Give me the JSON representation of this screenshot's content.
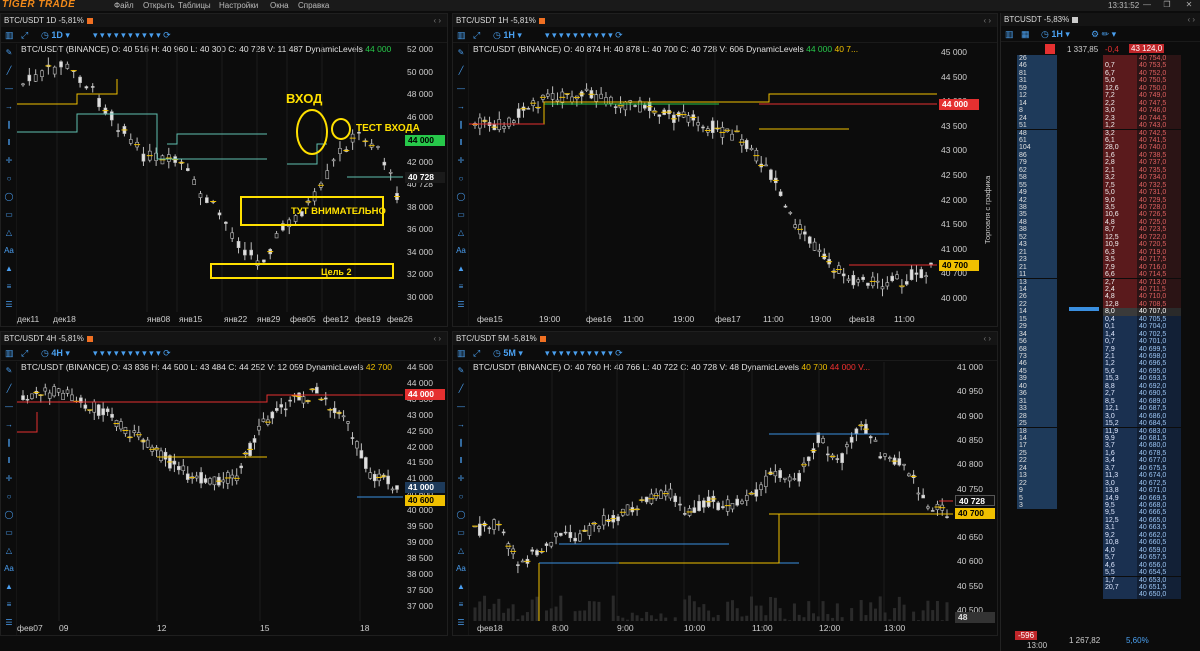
{
  "app": {
    "logo": "TIGER TRADE",
    "menu": [
      "Файл",
      "Открыть",
      "Таблицы",
      "Настройки",
      "Окна",
      "Справка"
    ],
    "clock": "13:31:52"
  },
  "colors": {
    "up": "#d8d8d8",
    "accent": "#f07022",
    "green": "#27c84a",
    "yellow": "#f0c000",
    "red": "#e53030",
    "blue": "#3a8fe0"
  },
  "panel1": {
    "title": "BTC/USDT 1D -5,81%",
    "timeframe": "1D",
    "info": "BTC/USDT (BINANCE) O: 40 516  H: 40 960  L: 40 300  C: 40 728  V: 11 487  DynamicLevels",
    "info_level": "44 000",
    "yticks": [
      "52 000",
      "50 000",
      "48 000",
      "46 000",
      "44 000",
      "42 000",
      "40 728",
      "38 000",
      "36 000",
      "34 000",
      "32 000",
      "30 000"
    ],
    "xticks": [
      "дек11",
      "дек18",
      "янв08",
      "янв15",
      "янв22",
      "янв29",
      "фев05",
      "фев12",
      "фев19",
      "фев26"
    ],
    "price_green": "44 000",
    "price_last": "40 728",
    "annotations": {
      "entry": "ВХОД",
      "entry_test": "ТЕСТ ВХОДА",
      "careful": "ТУТ ВНИМАТЕЛЬНО",
      "target": "Цель 2"
    }
  },
  "panel2": {
    "title": "BTC/USDT 1H -5,81%",
    "timeframe": "1H",
    "info": "BTC/USDT (BINANCE) O: 40 874  H: 40 878  L: 40 700  C: 40 728  V: 606  DynamicLevels",
    "info_g": "44 000",
    "info_y": "40 7...",
    "yticks": [
      "45 000",
      "44 500",
      "44 000",
      "43 500",
      "43 000",
      "42 500",
      "42 000",
      "41 500",
      "41 000",
      "40 700",
      "40 000"
    ],
    "xticks": [
      "фев15",
      "19:00",
      "фев16",
      "11:00",
      "19:00",
      "фев17",
      "11:00",
      "19:00",
      "фев18",
      "11:00"
    ],
    "price_red": "44 000",
    "price_yellow": "40 700",
    "side_label": "Торговля с графика"
  },
  "panel3": {
    "title": "BTC/USDT 4H -5,81%",
    "timeframe": "4H",
    "info": "BTC/USDT (BINANCE) O: 43 836  H: 44 500  L: 43 484  C: 44 252  V: 12 059  DynamicLevels",
    "info_y": "42 700",
    "yticks": [
      "44 500",
      "44 000",
      "43 500",
      "43 000",
      "42 500",
      "42 000",
      "41 500",
      "41 000",
      "40 600",
      "40 000",
      "39 500",
      "39 000",
      "38 500",
      "38 000",
      "37 500",
      "37 000"
    ],
    "xticks": [
      "фев07",
      "09",
      "12",
      "15",
      "18"
    ],
    "price_red": "44 000",
    "price_blue": "41 000",
    "price_yellow": "40 600"
  },
  "panel4": {
    "title": "BTC/USDT 5M -5,81%",
    "timeframe": "5M",
    "info": "BTC/USDT (BINANCE) O: 40 760  H: 40 766  L: 40 722  C: 40 728  V: 48  DynamicLevels",
    "info_y": "40 700",
    "info_r": "44 000  V...",
    "yticks": [
      "41 000",
      "40 950",
      "40 900",
      "40 850",
      "40 800",
      "40 750",
      "40 700",
      "40 650",
      "40 600",
      "40 550",
      "40 500"
    ],
    "xticks": [
      "фев18",
      "8:00",
      "9:00",
      "10:00",
      "11:00",
      "12:00",
      "13:00"
    ],
    "price_last": "40 728",
    "price_yellow": "40 700",
    "vol": "48"
  },
  "orderbook": {
    "title": "BTCUSDT -5,83%",
    "timeframe": "1H",
    "head_left": "1 337,85",
    "head_mid": "-0,4",
    "head_right": "43 124,0",
    "asks": [
      [
        "26",
        "",
        "40 754,0"
      ],
      [
        "46",
        "0,7",
        "40 753,5"
      ],
      [
        "81",
        "6,7",
        "40 752,0"
      ],
      [
        "31",
        "5,0",
        "40 750,5"
      ],
      [
        "59",
        "12,6",
        "40 750,0"
      ],
      [
        "12",
        "7,2",
        "40 749,0"
      ],
      [
        "14",
        "2,2",
        "40 747,5"
      ],
      [
        "8",
        "3,0",
        "40 746,0"
      ],
      [
        "24",
        "2,3",
        "40 744,5"
      ],
      [
        "51",
        "1,2",
        "40 743,0"
      ],
      [
        "48",
        "3,2",
        "40 742,5"
      ],
      [
        "61",
        "6,1",
        "40 741,5"
      ],
      [
        "104",
        "28,0",
        "40 740,0"
      ],
      [
        "86",
        "1,6",
        "40 738,5"
      ],
      [
        "79",
        "2,8",
        "40 737,0"
      ],
      [
        "62",
        "2,1",
        "40 735,5"
      ],
      [
        "58",
        "3,2",
        "40 734,0"
      ],
      [
        "55",
        "7,5",
        "40 732,5"
      ],
      [
        "49",
        "5,0",
        "40 731,0"
      ],
      [
        "42",
        "9,0",
        "40 729,5"
      ],
      [
        "38",
        "3,5",
        "40 728,0"
      ],
      [
        "35",
        "10,6",
        "40 726,5"
      ],
      [
        "48",
        "4,8",
        "40 725,0"
      ],
      [
        "38",
        "8,7",
        "40 723,5"
      ],
      [
        "52",
        "12,5",
        "40 722,0"
      ],
      [
        "43",
        "10,9",
        "40 720,5"
      ],
      [
        "21",
        "6,3",
        "40 719,0"
      ],
      [
        "23",
        "3,5",
        "40 717,5"
      ],
      [
        "21",
        "7,9",
        "40 716,0"
      ],
      [
        "11",
        "6,6",
        "40 714,5"
      ],
      [
        "13",
        "2,7",
        "40 713,0"
      ],
      [
        "14",
        "2,4",
        "40 711,5"
      ],
      [
        "26",
        "4,8",
        "40 710,0"
      ],
      [
        "22",
        "12,8",
        "40 708,5"
      ]
    ],
    "spread_row": [
      "14",
      "8,0",
      "40 707,0"
    ],
    "bids": [
      [
        "15",
        "0,4",
        "40 705,5"
      ],
      [
        "29",
        "0,1",
        "40 704,0"
      ],
      [
        "34",
        "1,4",
        "40 702,5"
      ],
      [
        "56",
        "0,7",
        "40 701,0"
      ],
      [
        "68",
        "7,9",
        "40 699,5"
      ],
      [
        "73",
        "2,1",
        "40 698,0"
      ],
      [
        "46",
        "1,2",
        "40 696,5"
      ],
      [
        "45",
        "5,6",
        "40 695,0"
      ],
      [
        "39",
        "15,3",
        "40 693,5"
      ],
      [
        "40",
        "8,8",
        "40 692,0"
      ],
      [
        "36",
        "2,7",
        "40 690,5"
      ],
      [
        "31",
        "8,5",
        "40 689,0"
      ],
      [
        "33",
        "12,1",
        "40 687,5"
      ],
      [
        "28",
        "3,0",
        "40 686,0"
      ],
      [
        "25",
        "15,2",
        "40 684,5"
      ],
      [
        "18",
        "11,9",
        "40 683,0"
      ],
      [
        "14",
        "9,9",
        "40 681,5"
      ],
      [
        "17",
        "3,7",
        "40 680,0"
      ],
      [
        "25",
        "1,6",
        "40 678,5"
      ],
      [
        "22",
        "3,4",
        "40 677,0"
      ],
      [
        "24",
        "3,7",
        "40 675,5"
      ],
      [
        "13",
        "11,3",
        "40 674,0"
      ],
      [
        "22",
        "3,0",
        "40 672,5"
      ],
      [
        "9",
        "13,8",
        "40 671,0"
      ],
      [
        "5",
        "14,9",
        "40 669,5"
      ],
      [
        "3",
        "9,5",
        "40 668,0"
      ],
      [
        "",
        "9,5",
        "40 666,5"
      ],
      [
        "",
        "12,5",
        "40 665,0"
      ],
      [
        "",
        "3,1",
        "40 663,5"
      ],
      [
        "",
        "9,2",
        "40 662,0"
      ],
      [
        "",
        "10,8",
        "40 660,5"
      ],
      [
        "",
        "4,0",
        "40 659,0"
      ],
      [
        "",
        "5,7",
        "40 657,5"
      ],
      [
        "",
        "4,6",
        "40 656,0"
      ],
      [
        "",
        "5,5",
        "40 654,5"
      ],
      [
        "",
        "1,7",
        "40 653,0"
      ],
      [
        "",
        "20,7",
        "40 651,5"
      ],
      [
        "",
        "",
        "40 650,0"
      ]
    ],
    "foot_left": "-596",
    "foot_time": "13:00",
    "foot_mid": "1 267,82",
    "foot_pct": "5,60%"
  }
}
